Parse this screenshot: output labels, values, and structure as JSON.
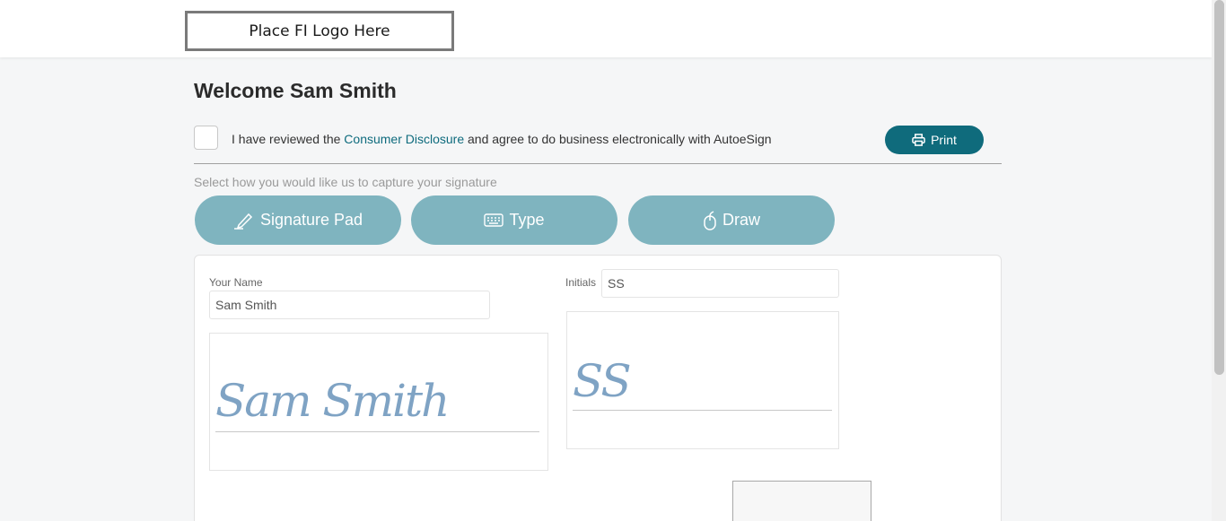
{
  "header": {
    "logo_text": "Place FI Logo Here"
  },
  "welcome": {
    "title": "Welcome Sam Smith"
  },
  "agreement": {
    "prefix": "I have reviewed the ",
    "link": "Consumer Disclosure",
    "suffix": " and agree to do business electronically with AutoeSign",
    "checked": false
  },
  "print": {
    "label": "Print"
  },
  "capture": {
    "prompt": "Select how you would like us to capture your signature",
    "modes": [
      {
        "label": "Signature Pad",
        "icon": "pen-icon"
      },
      {
        "label": "Type",
        "icon": "keyboard-icon"
      },
      {
        "label": "Draw",
        "icon": "mouse-icon"
      }
    ]
  },
  "form": {
    "name_label": "Your Name",
    "name_value": "Sam Smith",
    "initials_label": "Initials",
    "initials_value": "SS",
    "signature_text": "Sam Smith",
    "initials_signature_text": "SS"
  },
  "colors": {
    "primary": "#0f6b7c",
    "mode_button": "#7fb4bf",
    "link": "#0e6b7d",
    "signature_ink": "#7fa3c4"
  }
}
